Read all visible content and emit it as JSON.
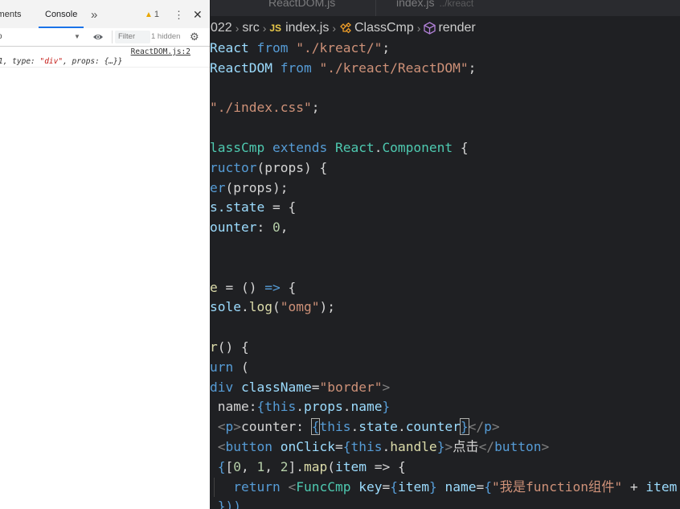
{
  "devtools": {
    "tabs": {
      "elements": "lements",
      "console": "Console",
      "more": "»"
    },
    "warnings": "1",
    "toolbar": {
      "context": "o",
      "filter_placeholder": "Filter",
      "hidden": "1 hidden"
    },
    "log": {
      "source": "ReactDOM.js:2",
      "text_pre": "1, type: ",
      "text_str": "\"div\"",
      "text_post": ", props: {…}}"
    }
  },
  "editor": {
    "tabs": [
      {
        "label": "ReactDOM.js"
      },
      {
        "label": "index.js",
        "hint": "../kreact"
      }
    ],
    "breadcrumb": {
      "folder": "022",
      "src": "src",
      "file_badge": "JS",
      "file": "index.js",
      "class": "ClassCmp",
      "method": "render"
    },
    "code": [
      [
        "React",
        " from ",
        "\"./kreact/\"",
        ";"
      ],
      [
        "ReactDOM",
        " from ",
        "\"./kreact/ReactDOM\"",
        ";"
      ],
      [],
      [
        "\"./index.css\"",
        ";"
      ],
      [],
      [
        "lassCmp",
        " extends ",
        "React",
        ".",
        "Component",
        " {"
      ],
      [
        "ructor",
        "(props) {"
      ],
      [
        "er",
        "(props);"
      ],
      [
        "s.state",
        " = {"
      ],
      [
        "ounter",
        ": ",
        "0",
        ","
      ],
      [],
      [],
      [
        "e",
        " = () ",
        "=>",
        " {"
      ],
      [
        "sole",
        ".",
        "log",
        "(",
        "\"omg\"",
        ");"
      ],
      [],
      [
        "r",
        "() {"
      ],
      [
        "urn",
        " ("
      ],
      [
        "div",
        " ",
        "className",
        "=",
        "\"border\"",
        ">"
      ],
      [
        " name:",
        "{",
        "this",
        ".",
        "props",
        ".",
        "name",
        "}"
      ],
      [
        " ",
        "<",
        "p",
        ">",
        "counter: ",
        "{",
        "this",
        ".",
        "state",
        ".",
        "counter",
        "}",
        "</",
        "p",
        ">"
      ],
      [
        " ",
        "<",
        "button",
        " ",
        "onClick",
        "=",
        "{",
        "this",
        ".",
        "handle",
        "}",
        ">",
        "点击",
        "</",
        "button",
        ">"
      ],
      [
        " ",
        "{",
        "[",
        "0",
        ", ",
        "1",
        ", ",
        "2",
        "].",
        "map",
        "(",
        "item",
        " => {"
      ],
      [
        "   ",
        "return",
        " ",
        "<",
        "FuncCmp",
        " ",
        "key",
        "=",
        "{",
        "item",
        "}",
        " ",
        "name",
        "=",
        "{",
        "\"我是function组件\"",
        " + ",
        "item"
      ],
      [
        " ",
        "}))"
      ]
    ]
  }
}
